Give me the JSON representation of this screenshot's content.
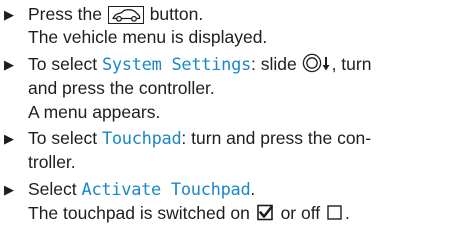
{
  "steps": [
    {
      "pre": "Press the",
      "post": "button.",
      "icon": "vehicle-button-icon",
      "result": "The vehicle menu is displayed."
    },
    {
      "pre": "To select",
      "highlight": "System Settings",
      "post": ": slide",
      "icon": "controller-slide-down-icon",
      "post2": ", turn",
      "cont": "and press the controller.",
      "result": "A menu appears."
    },
    {
      "pre": "To select",
      "highlight": "Touchpad",
      "post": ": turn and press the con-",
      "cont": "troller."
    },
    {
      "pre": "Select",
      "highlight": "Activate Touchpad",
      "post": ".",
      "result_pre": "The touchpad is switched on",
      "result_mid": "or off",
      "result_post": "."
    }
  ],
  "icons": {
    "bullet": "right-triangle-bullet",
    "checked": "checkbox-checked-icon",
    "unchecked": "checkbox-unchecked-icon"
  },
  "colors": {
    "highlight": "#1a87c9",
    "text": "#1e1e1e"
  }
}
